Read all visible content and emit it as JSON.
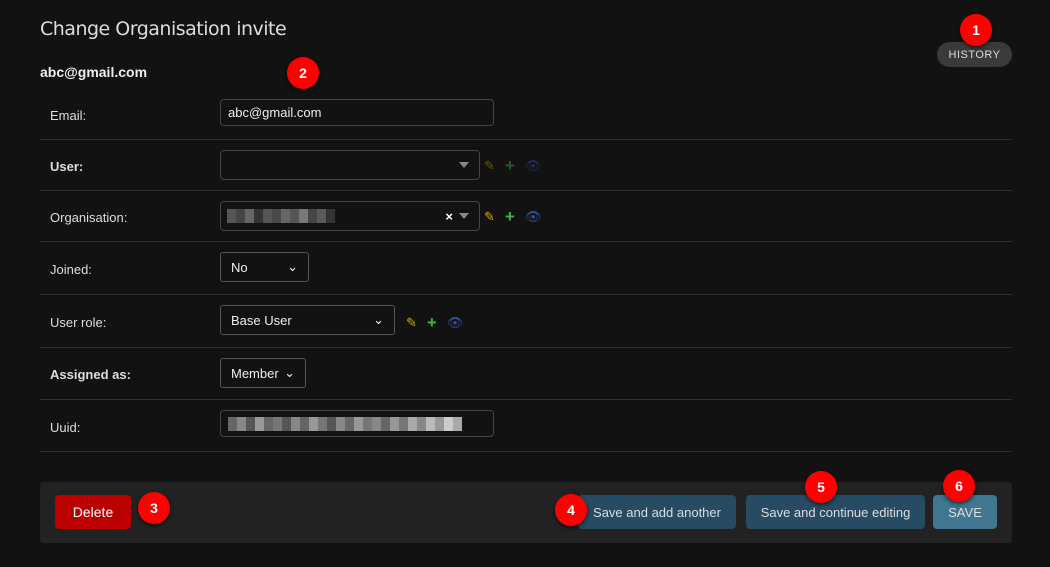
{
  "page": {
    "title": "Change Organisation invite",
    "subtitle": "abc@gmail.com",
    "history_label": "HISTORY"
  },
  "form": {
    "email": {
      "label": "Email:",
      "value": "abc@gmail.com"
    },
    "user": {
      "label": "User:",
      "value": ""
    },
    "organisation": {
      "label": "Organisation:",
      "value": "[redacted]",
      "clear": "×"
    },
    "joined": {
      "label": "Joined:",
      "value": "No"
    },
    "user_role": {
      "label": "User role:",
      "value": "Base User"
    },
    "assigned_as": {
      "label": "Assigned as:",
      "value": "Member"
    },
    "uuid": {
      "label": "Uuid:",
      "value": "[redacted]"
    }
  },
  "actions": {
    "delete": "Delete",
    "save_add": "Save and add another",
    "save_continue": "Save and continue editing",
    "save": "SAVE"
  },
  "annotations": [
    "1",
    "2",
    "3",
    "4",
    "5",
    "6"
  ],
  "colors": {
    "delete": "#ba0000",
    "save_secondary": "#264b63",
    "save_primary": "#417690",
    "badge": "#ff0000"
  }
}
